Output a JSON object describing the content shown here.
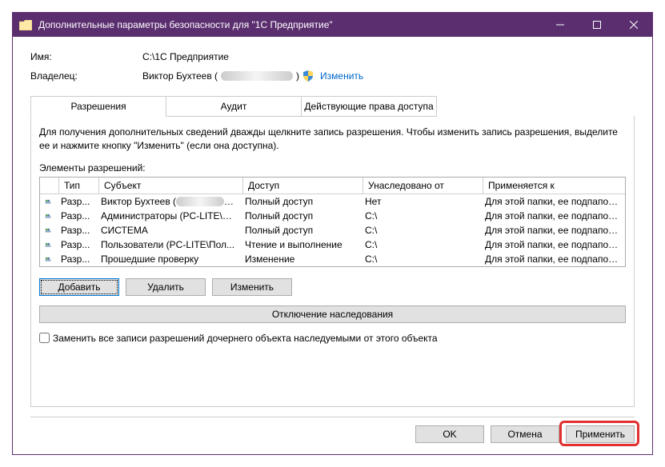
{
  "window": {
    "title": "Дополнительные параметры безопасности для \"1C Предприятие\""
  },
  "info": {
    "name_label": "Имя:",
    "name_value": "C:\\1C Предприятие",
    "owner_label": "Владелец:",
    "owner_value": "Виктор Бухтеев (",
    "owner_value_tail": ")",
    "change_link": "Изменить"
  },
  "tabs": {
    "perm": "Разрешения",
    "audit": "Аудит",
    "effective": "Действующие права доступа"
  },
  "panel": {
    "hint": "Для получения дополнительных сведений дважды щелкните запись разрешения. Чтобы изменить запись разрешения, выделите ее и нажмите кнопку \"Изменить\" (если она доступна).",
    "table_label": "Элементы разрешений:",
    "cols": {
      "type": "Тип",
      "subject": "Субъект",
      "access": "Доступ",
      "inherited": "Унаследовано от",
      "applies": "Применяется к"
    },
    "rows": [
      {
        "type": "Разр...",
        "subject": "Виктор Бухтеев (",
        "subject_redacted": true,
        "subject_tail": ")...",
        "access": "Полный доступ",
        "inherited": "Нет",
        "applies": "Для этой папки, ее подпапок ..."
      },
      {
        "type": "Разр...",
        "subject": "Администраторы (PC-LITE\\А...",
        "access": "Полный доступ",
        "inherited": "C:\\",
        "applies": "Для этой папки, ее подпапок ..."
      },
      {
        "type": "Разр...",
        "subject": "СИСТЕМА",
        "access": "Полный доступ",
        "inherited": "C:\\",
        "applies": "Для этой папки, ее подпапок ..."
      },
      {
        "type": "Разр...",
        "subject": "Пользователи (PC-LITE\\Пол...",
        "access": "Чтение и выполнение",
        "inherited": "C:\\",
        "applies": "Для этой папки, ее подпапок ..."
      },
      {
        "type": "Разр...",
        "subject": "Прошедшие проверку",
        "access": "Изменение",
        "inherited": "C:\\",
        "applies": "Для этой папки, ее подпапок ..."
      }
    ]
  },
  "buttons": {
    "add": "Добавить",
    "remove": "Удалить",
    "edit": "Изменить",
    "disable_inherit": "Отключение наследования",
    "replace_check": "Заменить все записи разрешений дочернего объекта наследуемыми от этого объекта",
    "ok": "OK",
    "cancel": "Отмена",
    "apply": "Применить"
  }
}
